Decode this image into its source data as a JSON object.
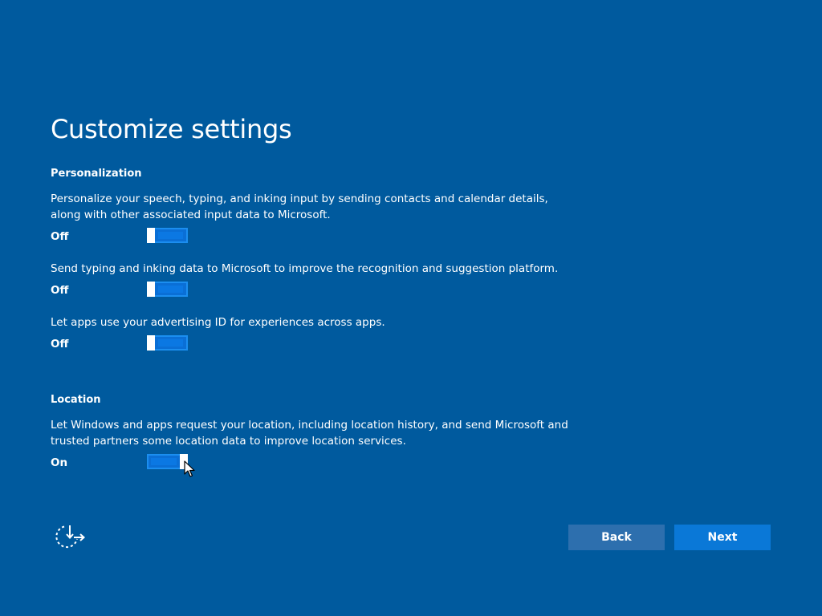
{
  "page": {
    "title": "Customize settings"
  },
  "personalization": {
    "heading": "Personalization",
    "items": [
      {
        "description": "Personalize your speech, typing, and inking input by sending contacts and calendar details, along with other associated input data to Microsoft.",
        "state_label": "Off",
        "value": false
      },
      {
        "description": "Send typing and inking data to Microsoft to improve the recognition and suggestion platform.",
        "state_label": "Off",
        "value": false
      },
      {
        "description": "Let apps use your advertising ID for experiences across apps.",
        "state_label": "Off",
        "value": false
      }
    ]
  },
  "location": {
    "heading": "Location",
    "items": [
      {
        "description": "Let Windows and apps request your location, including location history, and send Microsoft and trusted partners some location data to improve location services.",
        "state_label": "On",
        "value": true
      }
    ]
  },
  "footer": {
    "ease_of_access_icon": "ease-of-access-icon",
    "back_label": "Back",
    "next_label": "Next"
  },
  "colors": {
    "background": "#005a9e",
    "toggle_fill": "#0a78d7",
    "back_button": "#2d6fae",
    "next_button": "#0a78d7"
  }
}
